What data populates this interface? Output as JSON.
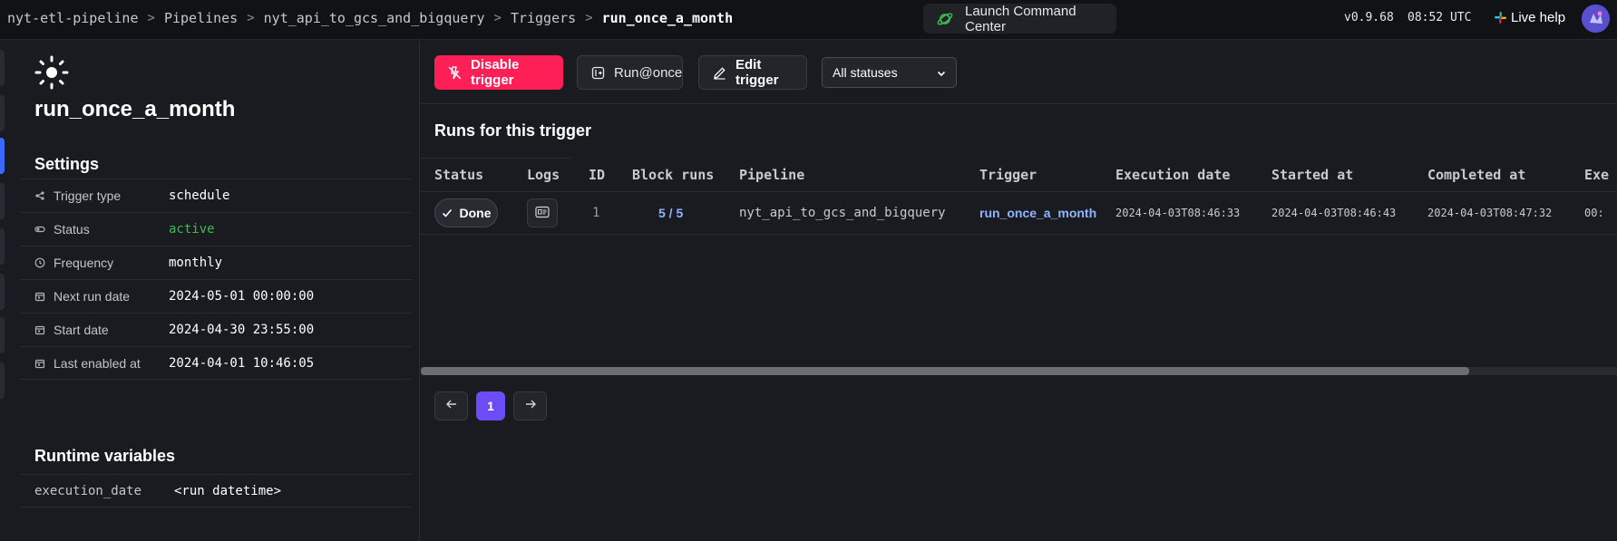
{
  "header": {
    "breadcrumb": [
      "nyt-etl-pipeline",
      "Pipelines",
      "nyt_api_to_gcs_and_bigquery",
      "Triggers",
      "run_once_a_month"
    ],
    "command_center": "Launch Command Center",
    "version": "v0.9.68",
    "time": "08:52 UTC",
    "live_help": "Live help"
  },
  "trigger": {
    "name": "run_once_a_month",
    "settings_title": "Settings",
    "settings": [
      {
        "label": "Trigger type",
        "value": "schedule",
        "icon": "share-icon"
      },
      {
        "label": "Status",
        "value": "active",
        "icon": "toggle-icon"
      },
      {
        "label": "Frequency",
        "value": "monthly",
        "icon": "clock-icon"
      },
      {
        "label": "Next run date",
        "value": "2024-05-01 00:00:00",
        "icon": "calendar-icon"
      },
      {
        "label": "Start date",
        "value": "2024-04-30 23:55:00",
        "icon": "calendar-icon"
      },
      {
        "label": "Last enabled at",
        "value": "2024-04-01 10:46:05",
        "icon": "calendar-icon"
      }
    ],
    "runtime_title": "Runtime variables",
    "runtime": [
      {
        "label": "execution_date",
        "value": "<run datetime>"
      }
    ]
  },
  "toolbar": {
    "disable": "Disable trigger",
    "run_once": "Run@once",
    "edit": "Edit trigger",
    "status_filter": "All statuses"
  },
  "runs": {
    "title": "Runs for this trigger",
    "columns": [
      "Status",
      "Logs",
      "ID",
      "Block runs",
      "Pipeline",
      "Trigger",
      "Execution date",
      "Started at",
      "Completed at",
      "Exe"
    ],
    "rows": [
      {
        "status": "Done",
        "id": "1",
        "block_runs": "5 / 5",
        "pipeline": "nyt_api_to_gcs_and_bigquery",
        "trigger": "run_once_a_month",
        "execution_date": "2024-04-03T08:46:33",
        "started_at": "2024-04-03T08:46:43",
        "completed_at": "2024-04-03T08:47:32",
        "extra": "00:"
      }
    ]
  },
  "pagination": {
    "current_page": "1"
  },
  "colors": {
    "accent_red": "#ff1f57",
    "link_blue": "#8fb4ff",
    "page_purple": "#6b4cf6",
    "status_green": "#3fb950"
  }
}
